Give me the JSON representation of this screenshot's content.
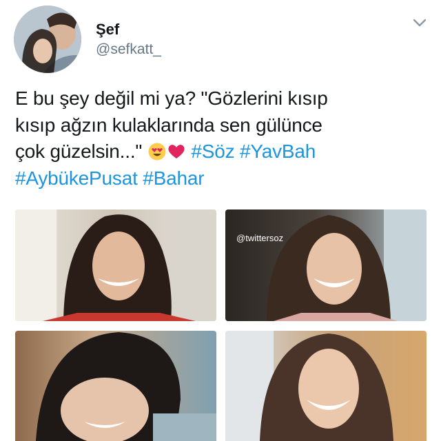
{
  "user": {
    "name": "Şef",
    "handle": "@sefkatt_"
  },
  "menu": {
    "icon": "chevron-down-icon"
  },
  "tweet": {
    "line1": "E bu şey değil mi ya? \"Gözlerini kısıp",
    "line2": "kısıp ağzın kulaklarında sen gülünce",
    "line3_text": "çok güzelsin...\"",
    "emoji": [
      "smiling-face-with-heart-eyes-icon",
      "red-heart-icon"
    ],
    "hashtags_line3": [
      "#Söz",
      "#YavBah"
    ],
    "hashtags_line4": [
      "#AybükePusat",
      "#Bahar"
    ]
  },
  "media": {
    "watermark": "@twittersoz",
    "photo_count": 4
  },
  "colors": {
    "link": "#1b95e0",
    "secondary_text": "#657786",
    "text": "#14171a"
  }
}
